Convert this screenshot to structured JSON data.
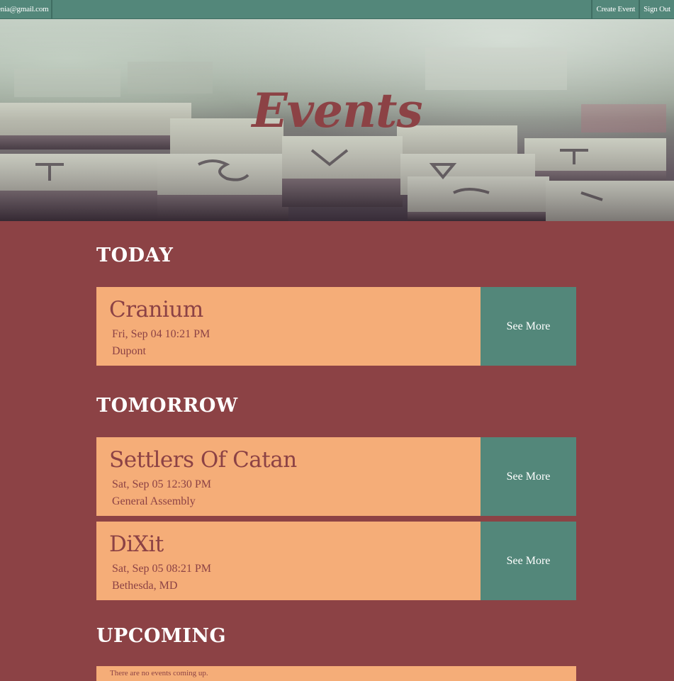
{
  "topbar": {
    "email": "senia@gmail.com",
    "create_event": "Create Event",
    "sign_out": "Sign Out"
  },
  "hero": {
    "title": "Events"
  },
  "sections": {
    "today": {
      "heading": "TODAY",
      "events": [
        {
          "name": "Cranium",
          "date": "Fri, Sep 04 10:21 PM",
          "location": "Dupont",
          "action": "See More"
        }
      ]
    },
    "tomorrow": {
      "heading": "TOMORROW",
      "events": [
        {
          "name": "Settlers Of Catan",
          "date": "Sat, Sep 05 12:30 PM",
          "location": "General Assembly",
          "action": "See More"
        },
        {
          "name": "DiXit",
          "date": "Sat, Sep 05 08:21 PM",
          "location": "Bethesda, MD",
          "action": "See More"
        }
      ]
    },
    "upcoming": {
      "heading": "UPCOMING",
      "empty_message": "There are no events coming up."
    }
  },
  "colors": {
    "background": "#8c4245",
    "accent": "#53877a",
    "card": "#f5ad78",
    "text_on_card": "#8c4245"
  }
}
